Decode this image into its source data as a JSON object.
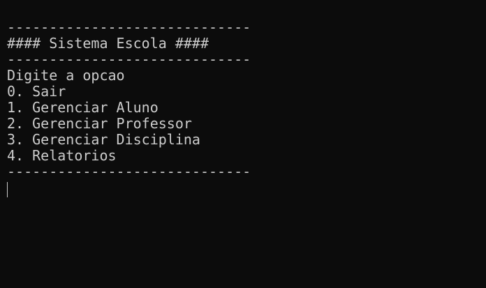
{
  "terminal": {
    "separator_top": "-----------------------------",
    "title": "#### Sistema Escola ####",
    "separator_mid": "-----------------------------",
    "prompt": "Digite a opcao",
    "options": [
      "0. Sair",
      "1. Gerenciar Aluno",
      "2. Gerenciar Professor",
      "3. Gerenciar Disciplina",
      "4. Relatorios"
    ],
    "separator_bottom": "-----------------------------"
  },
  "colors": {
    "background": "#0c0c0c",
    "text": "#cccccc"
  }
}
